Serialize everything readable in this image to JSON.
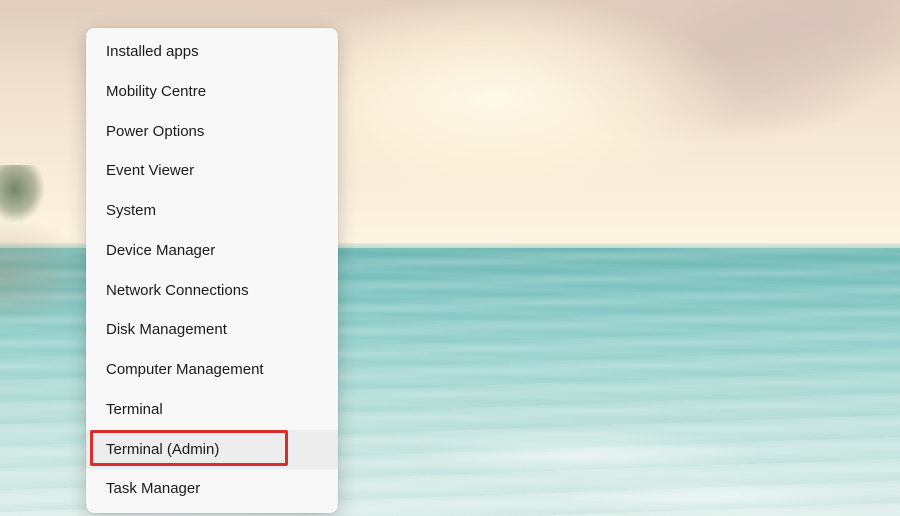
{
  "menu": {
    "items": [
      {
        "label": "Installed apps"
      },
      {
        "label": "Mobility Centre"
      },
      {
        "label": "Power Options"
      },
      {
        "label": "Event Viewer"
      },
      {
        "label": "System"
      },
      {
        "label": "Device Manager"
      },
      {
        "label": "Network Connections"
      },
      {
        "label": "Disk Management"
      },
      {
        "label": "Computer Management"
      },
      {
        "label": "Terminal"
      },
      {
        "label": "Terminal (Admin)",
        "hovered": true,
        "highlighted": true
      },
      {
        "label": "Task Manager"
      }
    ]
  },
  "highlight": {
    "color": "#d82e2e"
  }
}
